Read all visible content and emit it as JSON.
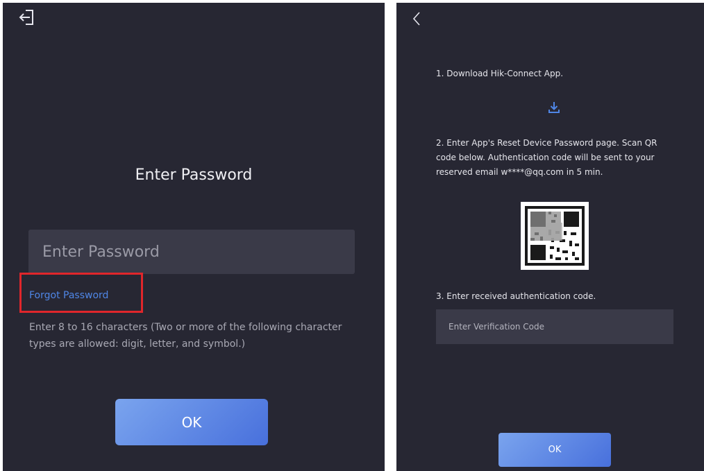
{
  "left_screen": {
    "icon": "logout-icon",
    "title": "Enter Password",
    "password_placeholder": "Enter Password",
    "forgot_password": "Forgot Password",
    "hint": "Enter 8 to 16 characters (Two or more of the following character types are allowed: digit, letter, and symbol.)",
    "ok_label": "OK"
  },
  "right_screen": {
    "back_icon": "back-icon",
    "download_icon": "download-icon",
    "step1": "1. Download Hik-Connect App.",
    "step2": "2. Enter App's Reset Device Password page. Scan QR code below. Authentication code will be sent to your reserved email w****@qq.com in 5 min.",
    "step3": "3. Enter received authentication code.",
    "code_placeholder": "Enter Verification Code",
    "ok_label": "OK"
  },
  "colors": {
    "screen_bg": "#272733",
    "input_bg": "#3a3a48",
    "link_blue": "#4f86e6",
    "button_gradient_start": "#7aa4ee",
    "button_gradient_end": "#4870dc",
    "highlight_red": "#e0262b"
  }
}
